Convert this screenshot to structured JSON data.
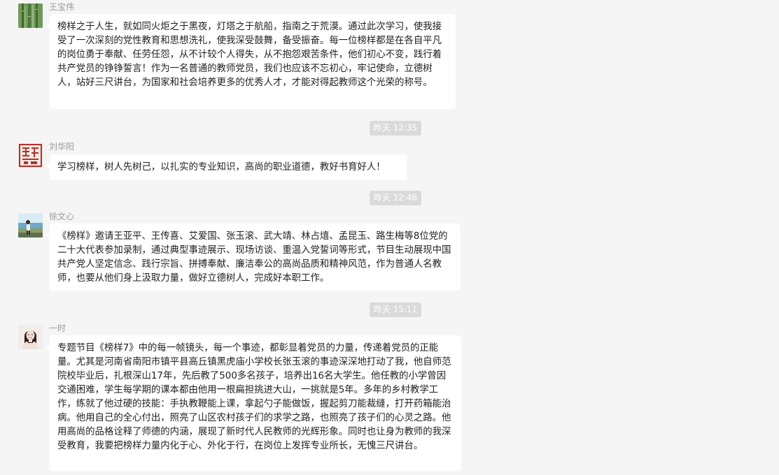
{
  "messages": [
    {
      "sender": "王宝伟",
      "text": "榜样之于人生，就如同火炬之于黑夜，灯塔之于航船，指南之于荒漠。通过此次学习，使我接受了一次深刻的党性教育和思想洗礼，使我深受鼓舞，备受振奋。每一位榜样都是在各自平凡的岗位勇于奉献、任劳任怨，从不计较个人得失，从不抱怨艰苦条件，他们初心不变，践行着共产党员的铮铮誓言！作为一名普通的教师党员，我们也应该不忘初心，牢记使命，立德树人，站好三尺讲台，为国家和社会培养更多的优秀人才，才能对得起教师这个光荣的称号。",
      "avatar_icon": "bamboo-avatar-icon"
    },
    {
      "sender": "刘华阳",
      "text": "学习榜样，树人先树己，以扎实的专业知识，高尚的职业道德，教好书育好人！",
      "avatar_icon": "red-seal-avatar-icon"
    },
    {
      "sender": "徐文心",
      "text": "《榜样》邀请王亚平、王传喜、艾爱国、张玉滚、武大靖、林占熺、孟昆玉、路生梅等8位党的二十大代表参加录制，通过典型事迹展示、现场访谈、重温入党誓词等形式，节目生动展现中国共产党人坚定信念、践行宗旨、拼搏奉献、廉洁奉公的高尚品质和精神风范，作为普通人名教师，也要从他们身上汲取力量，做好立德树人，完成好本职工作。",
      "avatar_icon": "seaside-photo-avatar-icon"
    },
    {
      "sender": "一时",
      "text": "专题节目《榜样7》中的每一帧镜头，每一个事迹，都彰显着党员的力量，传递着党员的正能量。尤其是河南省南阳市镇平县高丘镇黑虎庙小学校长张玉滚的事迹深深地打动了我，他自师范院校毕业后，扎根深山17年，先后教了500多名孩子，培养出16名大学生。他任教的小学曾因交通困难，学生每学期的课本都由他用一根扁担挑进大山，一挑就是5年。多年的乡村教学工作，练就了他过硬的技能：手执教鞭能上课，拿起勺子能做饭，握起剪刀能裁缝，打开药箱能治病。他用自己的全心付出，照亮了山区农村孩子们的求学之路，也照亮了孩子们的心灵之路。他用高尚的品格诠释了师德的内涵，展现了新时代人民教师的光辉形象。同时也让身为教师的我深受教育，我要把榜样力量内化于心、外化于行，在岗位上发挥专业所长，无愧三尺讲台。",
      "avatar_icon": "woman-portrait-avatar-icon"
    }
  ],
  "timestamps": [
    "昨天 12:35",
    "昨天 12:46",
    "昨天 15:11"
  ],
  "colors": {
    "background": "#f5f5f5",
    "bubble": "#ffffff",
    "timestamp_pill": "#dadada",
    "sender_name": "#999999"
  }
}
